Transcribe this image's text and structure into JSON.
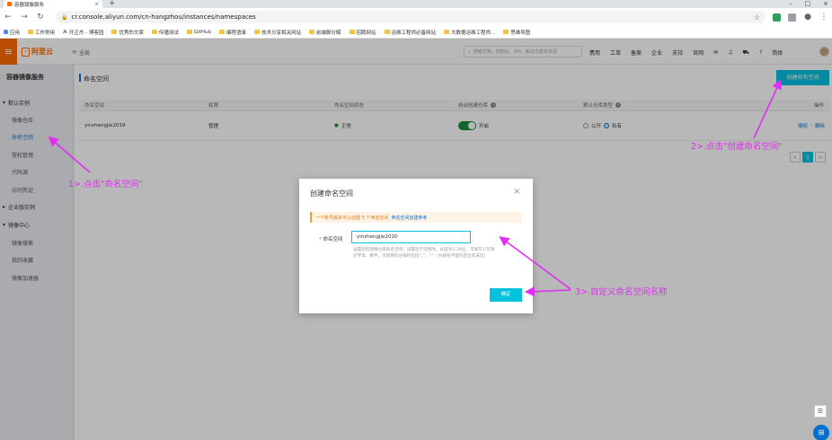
{
  "browser": {
    "tab_title": "容器镜像服务",
    "url": "cr.console.aliyun.com/cn-hangzhou/instances/namespaces",
    "bookmarks": [
      "应用",
      "工作常用",
      "开正杰 - 博客园",
      "优秀的文章",
      "传播测试",
      "GitHub",
      "编程语录",
      "技术分享相关网站",
      "前端脚分解",
      "招聘网站",
      "运维工程师必备网站",
      "大数据运维工程师...",
      "思维导图"
    ]
  },
  "topnav": {
    "brand": "阿里云",
    "region": "全局",
    "search_placeholder": "搜索文档、控制台、API、解决方案和资源",
    "links": [
      "费用",
      "工单",
      "备案",
      "企业",
      "支持",
      "官网"
    ]
  },
  "sidebar": {
    "title": "容器镜像服务",
    "groups": [
      {
        "label": "默认实例",
        "items": [
          "镜像仓库",
          "命名空间",
          "授权管理",
          "代码源",
          "访问凭证"
        ]
      },
      {
        "label": "企业版实例",
        "items": []
      },
      {
        "label": "镜像中心",
        "items": [
          "镜像搜索",
          "我的收藏",
          "镜像加速器"
        ]
      }
    ],
    "active_item": "命名空间"
  },
  "main": {
    "page_title": "命名空间",
    "create_button": "创建命名空间",
    "table": {
      "headers": [
        "命名空间",
        "权限",
        "命名空间状态",
        "自动创建仓库",
        "默认仓库类型",
        "操作"
      ],
      "rows": [
        {
          "namespace": "yinzhengjie2019",
          "permission": "管理",
          "status": "正常",
          "auto_create": "开启",
          "type_public": "公开",
          "type_private": "私有",
          "actions": [
            "授权",
            "删除"
          ]
        }
      ]
    },
    "pager": {
      "prev": "<",
      "current": "1",
      "next": ">"
    }
  },
  "dialog": {
    "title": "创建命名空间",
    "note": "一个账号最多可以创建 5 个命名空间",
    "note_link": "命名空间创建参考",
    "label": "命名空间",
    "input_value": "yinzhengjie2020",
    "help": "设置您的镜像仓库命名空间，设置后不可修改。长度为2-30位，可填写小写英文字母、数字，可使用的分隔符包括\"_\"、\"-\"（分隔符不能在首位或末位）",
    "ok_button": "确定"
  },
  "annotations": {
    "step1": "1>.点击\"命名空间\"",
    "step2": "2>.点击\"创建命名空间\"",
    "step3": "3>.自定义命名空间名称",
    "color": "#e02ff0"
  }
}
